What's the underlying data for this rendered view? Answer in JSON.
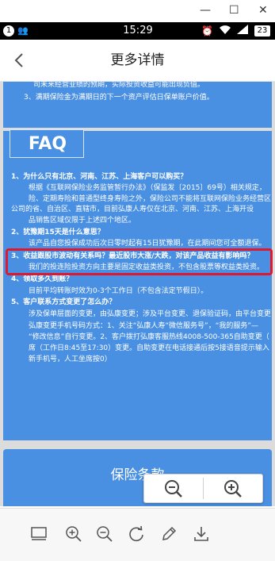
{
  "window": {
    "minimize": "—",
    "maximize": "☐",
    "close": "✕"
  },
  "status_bar": {
    "notification_count": "1",
    "time": "15:29",
    "battery": "23"
  },
  "header": {
    "title": "更多详情"
  },
  "document": {
    "top_lines": [
      "司未来经营业绩的预期，实际投资收益可能出现负值。",
      "3、满期保险金为满期日的下一个资产评估日保单账户价值。"
    ],
    "faq": {
      "heading": "FAQ",
      "lines": [
        {
          "text": "1、为什么只有北京、河南、江苏、上海客户可以购买？",
          "bold": true
        },
        {
          "text": "根据《互联网保险业务监管暂行办法》（保监发〔2015〕69号）相关规定，",
          "bold": false
        },
        {
          "text": "险、定期寿险和普通型终身寿险之外，保险公司不能将互联网保险业务经营区",
          "bold": false
        },
        {
          "text": "公司的省、自治区、直辖市，目前弘康人寿仅在北京、河南、江苏、上海开设",
          "bold": false
        },
        {
          "text": "品销售区域仅限于上述四个地区。",
          "bold": false
        },
        {
          "text": "2、犹豫期15天是什么意思？",
          "bold": true
        },
        {
          "text": "该产品自您投保成功后次日零时起有15日犹豫期，在此期间您可全额退保。",
          "bold": false
        },
        {
          "text": "3、收益跟股市波动有关系吗？最近股市大涨/大跌，对该产品收益有影响吗？",
          "bold": true
        },
        {
          "text": "我们的投连险投资方向主要是固定收益类投资，不包含股票等权益类投资。",
          "bold": false
        },
        {
          "text": "4、领取多久到账？",
          "bold": true
        },
        {
          "text": "目前平均转账时效为0-3个工作日（不包含法定节假日）。",
          "bold": false
        },
        {
          "text": "5、客户联系方式变更了怎么办？",
          "bold": true
        },
        {
          "text": "涉及保单层面的变更，由弘康变更；涉及平台变更、退保验证码，由平台变更",
          "bold": false
        },
        {
          "text": "弘康变更手机号码方式：1、关注“弘康人寿“微信服务号”，“我的服务”—",
          "bold": false
        },
        {
          "text": "“修改信息”自行变更。2、客户拨打弘康客服热线4008-500-365自助变更（",
          "bold": false
        },
        {
          "text": "席（工作日8:45至17:30）变更。自助变更在电话接通后按5接语音提示输入",
          "bold": false
        },
        {
          "text": "新手机号，人工坐席按0）",
          "bold": false
        }
      ]
    },
    "terms_button": "保险条款"
  },
  "zoom": {
    "out_icon": "zoom-out-icon",
    "in_icon": "zoom-in-icon"
  },
  "toolbar": {
    "icons": [
      "sidebar-icon",
      "zoom-in-icon",
      "zoom-out-icon",
      "rotate-icon",
      "edit-icon",
      "download-icon"
    ]
  },
  "colors": {
    "panel_blue": "#4a90e2",
    "highlight_red": "#e0182f",
    "doc_gray": "#dcdcdc"
  }
}
